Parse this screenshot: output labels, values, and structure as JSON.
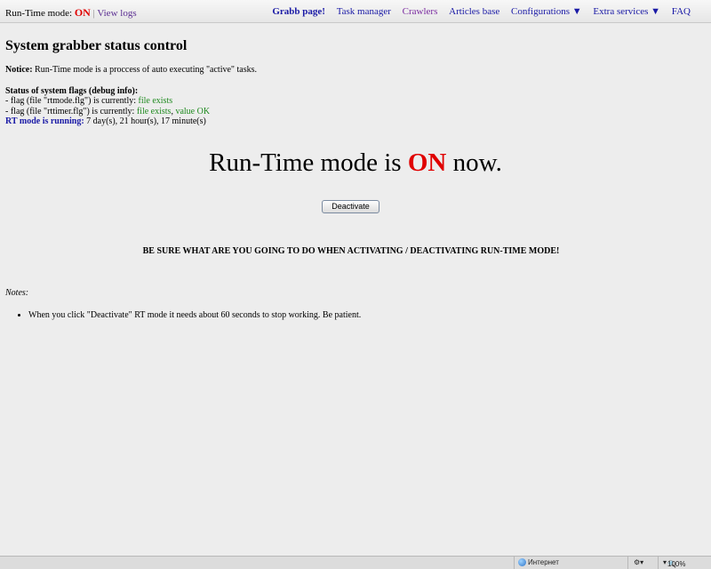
{
  "topbar": {
    "rt_mode_label": "Run-Time mode:",
    "rt_mode_value": "ON",
    "separator": "|",
    "view_logs": "View logs",
    "nav": [
      {
        "label": "Grabb page!"
      },
      {
        "label": "Task manager"
      },
      {
        "label": "Crawlers"
      },
      {
        "label": "Articles base"
      },
      {
        "label": "Configurations ▼"
      },
      {
        "label": "Extra services ▼"
      },
      {
        "label": "FAQ"
      }
    ]
  },
  "page": {
    "title": "System grabber status control",
    "notice_label": "Notice:",
    "notice_text": " Run-Time mode is a proccess of auto executing \"active\" tasks.",
    "flags_heading": "Status of system flags (debug info):",
    "flag1_prefix": "- flag (file \"rtmode.flg\") is currently: ",
    "flag1_status": "file exists",
    "flag2_prefix": "- flag (file \"rttimer.flg\") is currently: ",
    "flag2_status": "file exists",
    "flag2_sep": ", ",
    "flag2_value": "value OK",
    "rt_running_label": "RT mode is running:",
    "rt_running_value": " 7 day(s), 21 hour(s), 17 minute(s)",
    "big_prefix": "Run-Time mode is ",
    "big_state": "ON",
    "big_suffix": " now.",
    "deactivate_button": "Deactivate",
    "warning": "BE SURE WHAT ARE YOU GOING TO DO WHEN ACTIVATING / DEACTIVATING RUN-TIME MODE!",
    "notes_title": "Notes:",
    "notes": [
      "When you click \"Deactivate\" RT mode it needs about 60 seconds to stop working. Be patient."
    ]
  },
  "statusbar": {
    "zone": "Интернет",
    "zoom": "100%"
  },
  "colors": {
    "on_red": "#e00000",
    "link_blue": "#1a1aa6",
    "ok_green": "#1f8a1f",
    "visited_purple": "#7a2aa0"
  }
}
